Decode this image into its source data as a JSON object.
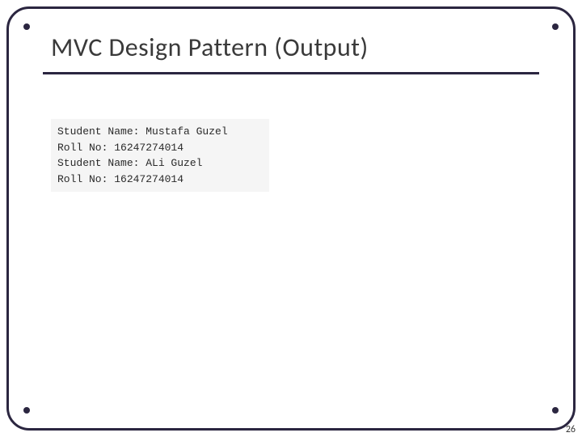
{
  "title": "MVC Design Pattern (Output)",
  "page_number": "26",
  "output": {
    "lines": [
      "Student Name: Mustafa Guzel",
      "Roll No: 16247274014",
      "Student Name: ALi Guzel",
      "Roll No: 16247274014"
    ]
  }
}
